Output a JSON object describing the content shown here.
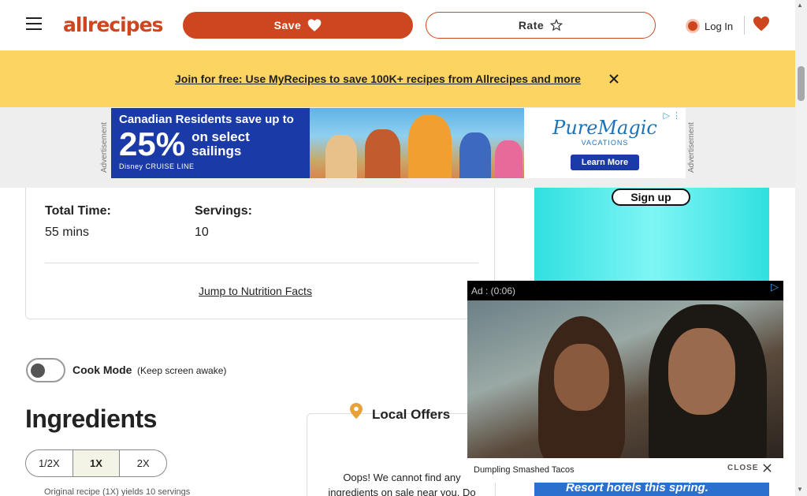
{
  "header": {
    "logo_text": "allrecipes",
    "save_label": "Save",
    "rate_label": "Rate",
    "login_label": "Log In"
  },
  "banner": {
    "text": "Join for free: Use MyRecipes to save 100K+ recipes from Allrecipes and more"
  },
  "top_ad": {
    "side_label": "Advertisement",
    "line1": "Canadian Residents save up to",
    "percent": "25%",
    "on_select": "on select",
    "sailings": "sailings",
    "brand": "Disney CRUISE LINE",
    "partner": "PureMagic",
    "partner_sub": "VACATIONS",
    "cta": "Learn More"
  },
  "recipe": {
    "total_time_label": "Total Time:",
    "total_time_value": "55 mins",
    "servings_label": "Servings:",
    "servings_value": "10",
    "jump_link": "Jump to Nutrition Facts"
  },
  "side_ad": {
    "signup_label": "Sign up",
    "bottom_text": "Resort hotels this spring."
  },
  "cook_mode": {
    "label": "Cook Mode",
    "note": "(Keep screen awake)"
  },
  "ingredients": {
    "heading": "Ingredients",
    "scale_options": [
      "1/2X",
      "1X",
      "2X"
    ],
    "active_scale": "1X",
    "original_note": "Original recipe (1X) yields 10 servings"
  },
  "local_offers": {
    "title": "Local Offers",
    "message": "Oops! We cannot find any ingredients on sale near you. Do"
  },
  "video_ad": {
    "ad_label": "Ad : (0:06)",
    "caption": "Dumpling Smashed Tacos",
    "close_label": "CLOSE"
  },
  "colors": {
    "brand": "#ce4620",
    "banner": "#fbd461"
  }
}
